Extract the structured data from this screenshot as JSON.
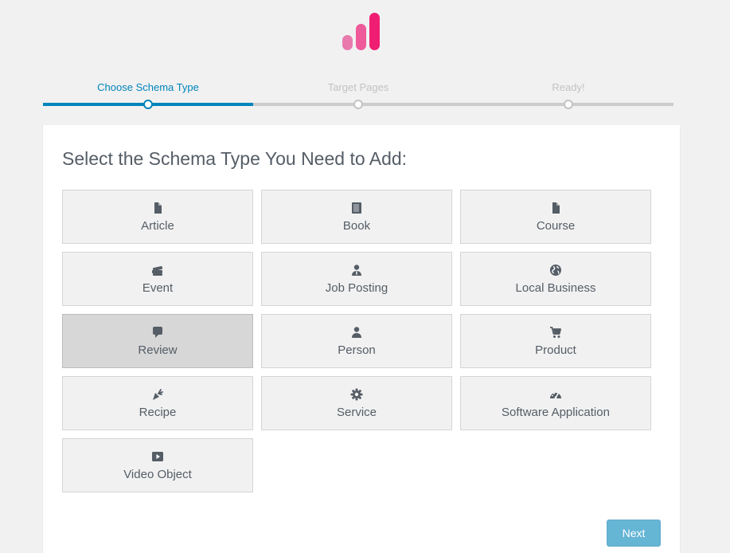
{
  "colors": {
    "accent": "#0085ba",
    "logo_light": "#e87aae",
    "logo_mid": "#ee5a9a",
    "logo_dark": "#f01e72",
    "icon": "#555d66"
  },
  "logo": {
    "icon": "bar-chart-logo"
  },
  "steps": [
    {
      "label": "Choose Schema Type",
      "state": "active"
    },
    {
      "label": "Target Pages",
      "state": "inactive"
    },
    {
      "label": "Ready!",
      "state": "inactive"
    }
  ],
  "heading": "Select the Schema Type You Need to Add:",
  "types": [
    {
      "label": "Article",
      "icon": "file-icon",
      "selected": false
    },
    {
      "label": "Book",
      "icon": "book-icon",
      "selected": false
    },
    {
      "label": "Course",
      "icon": "file-icon",
      "selected": false
    },
    {
      "label": "Event",
      "icon": "tickets-icon",
      "selected": false
    },
    {
      "label": "Job Posting",
      "icon": "user-tie-icon",
      "selected": false
    },
    {
      "label": "Local Business",
      "icon": "globe-icon",
      "selected": false
    },
    {
      "label": "Review",
      "icon": "comment-icon",
      "selected": true
    },
    {
      "label": "Person",
      "icon": "user-icon",
      "selected": false
    },
    {
      "label": "Product",
      "icon": "cart-icon",
      "selected": false
    },
    {
      "label": "Recipe",
      "icon": "carrot-icon",
      "selected": false
    },
    {
      "label": "Service",
      "icon": "gear-icon",
      "selected": false
    },
    {
      "label": "Software Application",
      "icon": "dashboard-icon",
      "selected": false
    },
    {
      "label": "Video Object",
      "icon": "video-icon",
      "selected": false
    }
  ],
  "next_label": "Next"
}
